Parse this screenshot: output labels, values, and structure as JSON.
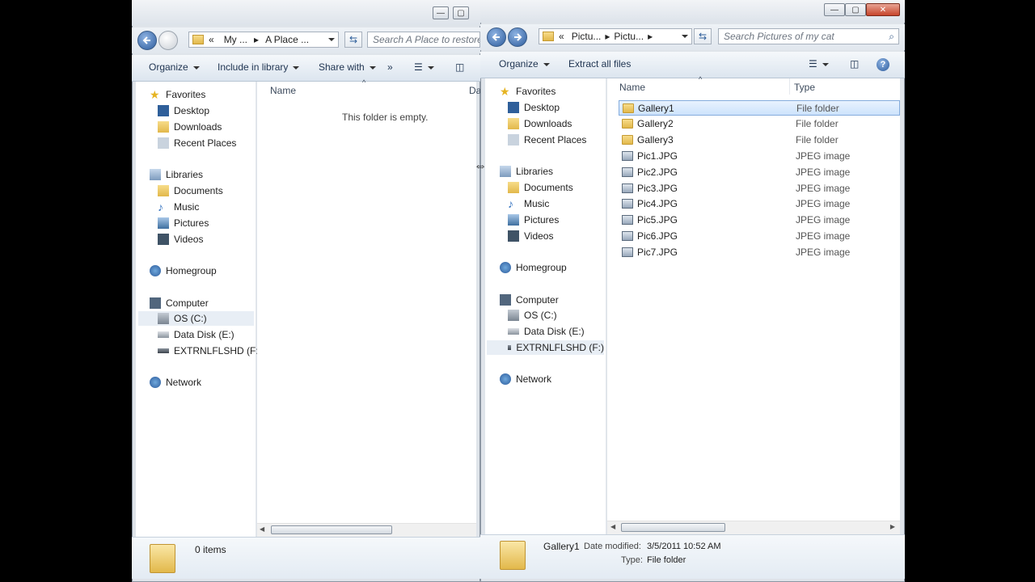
{
  "left_window": {
    "address_segments": [
      "«",
      "My ...",
      "▸",
      "A Place ..."
    ],
    "search_placeholder": "Search A Place to restore",
    "toolbar": {
      "organize": "Organize",
      "include": "Include in library",
      "share": "Share with",
      "more": "»"
    },
    "column_name": "Name",
    "column_partial": "Da",
    "empty_message": "This folder is empty.",
    "status_count": "0 items"
  },
  "right_window": {
    "address_segments": [
      "«",
      "Pictu...",
      "▸",
      "Pictu...",
      "▸"
    ],
    "search_placeholder": "Search Pictures of my cat",
    "toolbar": {
      "organize": "Organize",
      "extract": "Extract all files"
    },
    "columns": {
      "name": "Name",
      "type": "Type"
    },
    "files": [
      {
        "name": "Gallery1",
        "type": "File folder",
        "kind": "folder"
      },
      {
        "name": "Gallery2",
        "type": "File folder",
        "kind": "folder"
      },
      {
        "name": "Gallery3",
        "type": "File folder",
        "kind": "folder"
      },
      {
        "name": "Pic1.JPG",
        "type": "JPEG image",
        "kind": "jpg"
      },
      {
        "name": "Pic2.JPG",
        "type": "JPEG image",
        "kind": "jpg"
      },
      {
        "name": "Pic3.JPG",
        "type": "JPEG image",
        "kind": "jpg"
      },
      {
        "name": "Pic4.JPG",
        "type": "JPEG image",
        "kind": "jpg"
      },
      {
        "name": "Pic5.JPG",
        "type": "JPEG image",
        "kind": "jpg"
      },
      {
        "name": "Pic6.JPG",
        "type": "JPEG image",
        "kind": "jpg"
      },
      {
        "name": "Pic7.JPG",
        "type": "JPEG image",
        "kind": "jpg"
      }
    ],
    "details": {
      "name": "Gallery1",
      "date_label": "Date modified:",
      "date_value": "3/5/2011 10:52 AM",
      "type_label": "Type:",
      "type_value": "File folder"
    }
  },
  "nav": {
    "favorites": "Favorites",
    "desktop": "Desktop",
    "downloads": "Downloads",
    "recent": "Recent Places",
    "libraries": "Libraries",
    "documents": "Documents",
    "music": "Music",
    "pictures": "Pictures",
    "videos": "Videos",
    "homegroup": "Homegroup",
    "computer": "Computer",
    "os": "OS (C:)",
    "data": "Data Disk (E:)",
    "ext": "EXTRNLFLSHD (F:)",
    "network": "Network"
  }
}
